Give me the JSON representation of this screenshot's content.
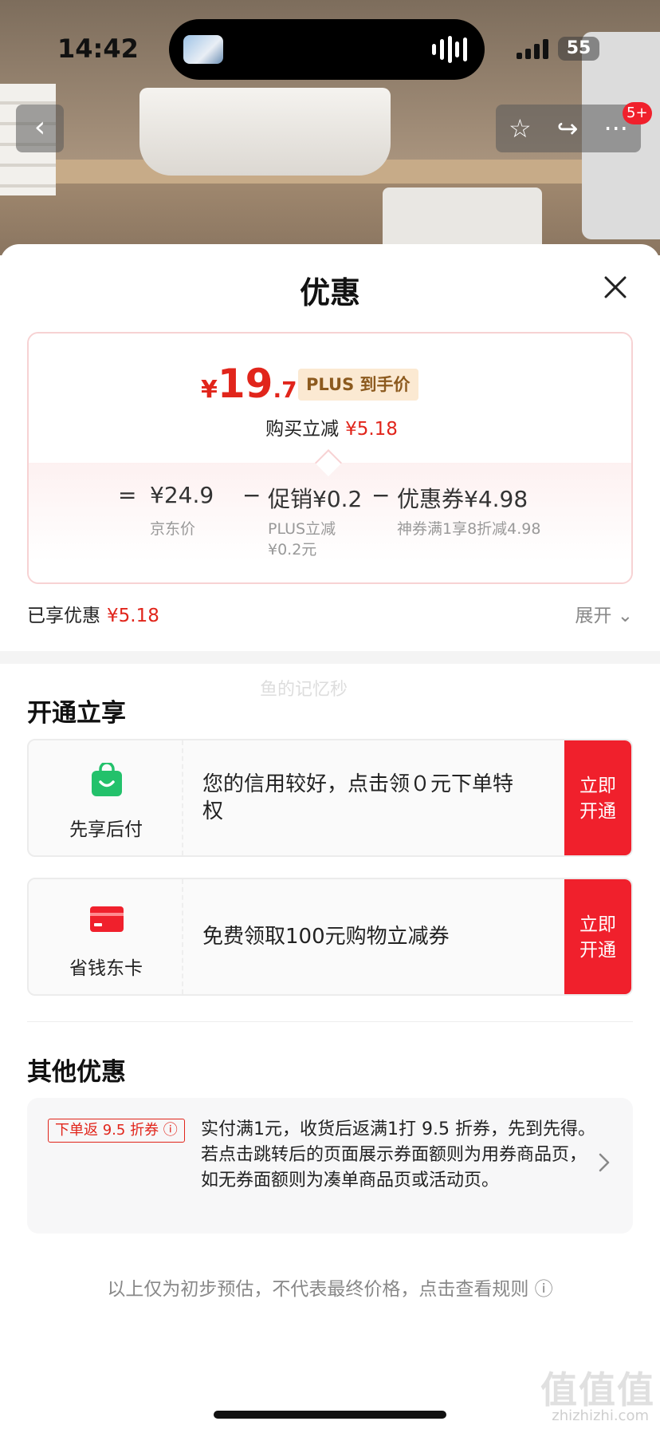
{
  "status": {
    "time": "14:42",
    "battery": "55"
  },
  "nav": {
    "back": "‹",
    "star": "☆",
    "share": "↪",
    "more": "···",
    "badge": "5+"
  },
  "sheet": {
    "title": "优惠",
    "close": "×"
  },
  "price": {
    "currency": "¥",
    "integer": "19",
    "decimal": ".72",
    "tag": "PLUS 到手价",
    "reduce_label": "购买立减",
    "reduce_value": "¥5.18"
  },
  "calc": {
    "eq": "=",
    "jd_price": "¥24.9",
    "jd_label": "京东价",
    "minus1": "−",
    "promo": "促销¥0.2",
    "promo_sub1": "PLUS立减",
    "promo_sub2": "¥0.2元",
    "minus2": "−",
    "coupon": "优惠券¥4.98",
    "coupon_sub": "神券满1享8折减4.98"
  },
  "enjoyed": {
    "label": "已享优惠",
    "value": "¥5.18",
    "expand": "展开 ⌄"
  },
  "watermark": "鱼的记忆秒",
  "open_section": {
    "title": "开通立享",
    "cards": [
      {
        "label": "先享后付",
        "desc": "您的信用较好，点击领０元下单特权",
        "btn": "立即开通",
        "icon": "shopping-bag-icon",
        "color": "#23c16b"
      },
      {
        "label": "省钱东卡",
        "desc": "免费领取100元购物立减券",
        "btn": "立即开通",
        "icon": "card-icon",
        "color": "#f0202c"
      }
    ]
  },
  "other_section": {
    "title": "其他优惠",
    "tag": "下单返 9.5 折券 ⓘ",
    "text": "实付满1元，收货后返满1打 9.5 折券，先到先得。若点击跳转后的页面展示券面额则为用券商品页，如无券面额则为凑单商品页或活动页。"
  },
  "footer": {
    "note": "以上仅为初步预估，不代表最终价格，点击查看规则 ⓘ"
  },
  "site": {
    "mark": "值值值",
    "url": "zhizhizhi.com"
  },
  "colors": {
    "accent_red": "#e1251b",
    "btn_red": "#f0202c",
    "plus_bg": "#fbe9d2"
  }
}
